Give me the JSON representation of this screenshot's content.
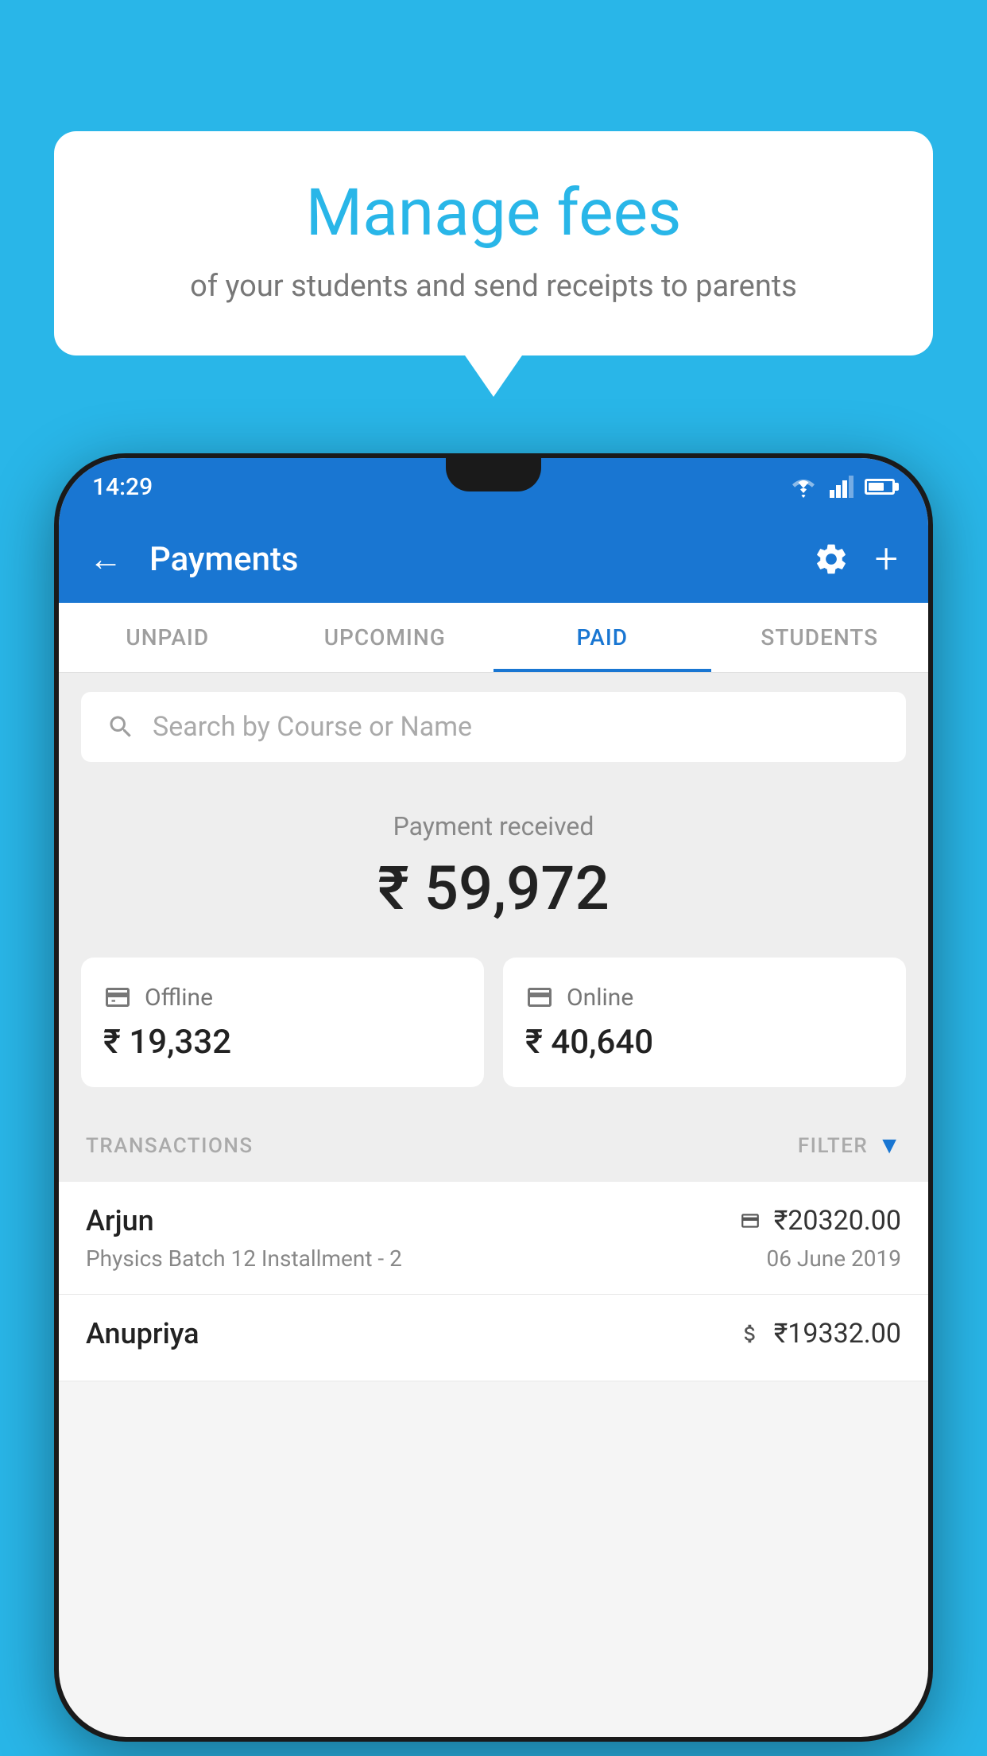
{
  "background_color": "#29b6e8",
  "bubble": {
    "title": "Manage fees",
    "subtitle": "of your students and send receipts to parents"
  },
  "status_bar": {
    "time": "14:29"
  },
  "app_bar": {
    "title": "Payments",
    "back_label": "←",
    "plus_label": "+"
  },
  "tabs": [
    {
      "label": "UNPAID",
      "active": false
    },
    {
      "label": "UPCOMING",
      "active": false
    },
    {
      "label": "PAID",
      "active": true
    },
    {
      "label": "STUDENTS",
      "active": false
    }
  ],
  "search": {
    "placeholder": "Search by Course or Name"
  },
  "payment_received": {
    "label": "Payment received",
    "amount": "₹ 59,972"
  },
  "payment_cards": [
    {
      "type": "Offline",
      "amount": "₹ 19,332"
    },
    {
      "type": "Online",
      "amount": "₹ 40,640"
    }
  ],
  "transactions_header": {
    "label": "TRANSACTIONS",
    "filter_label": "FILTER"
  },
  "transactions": [
    {
      "name": "Arjun",
      "course": "Physics Batch 12 Installment - 2",
      "amount": "₹20320.00",
      "date": "06 June 2019",
      "payment_type": "online"
    },
    {
      "name": "Anupriya",
      "course": "",
      "amount": "₹19332.00",
      "date": "",
      "payment_type": "offline"
    }
  ]
}
